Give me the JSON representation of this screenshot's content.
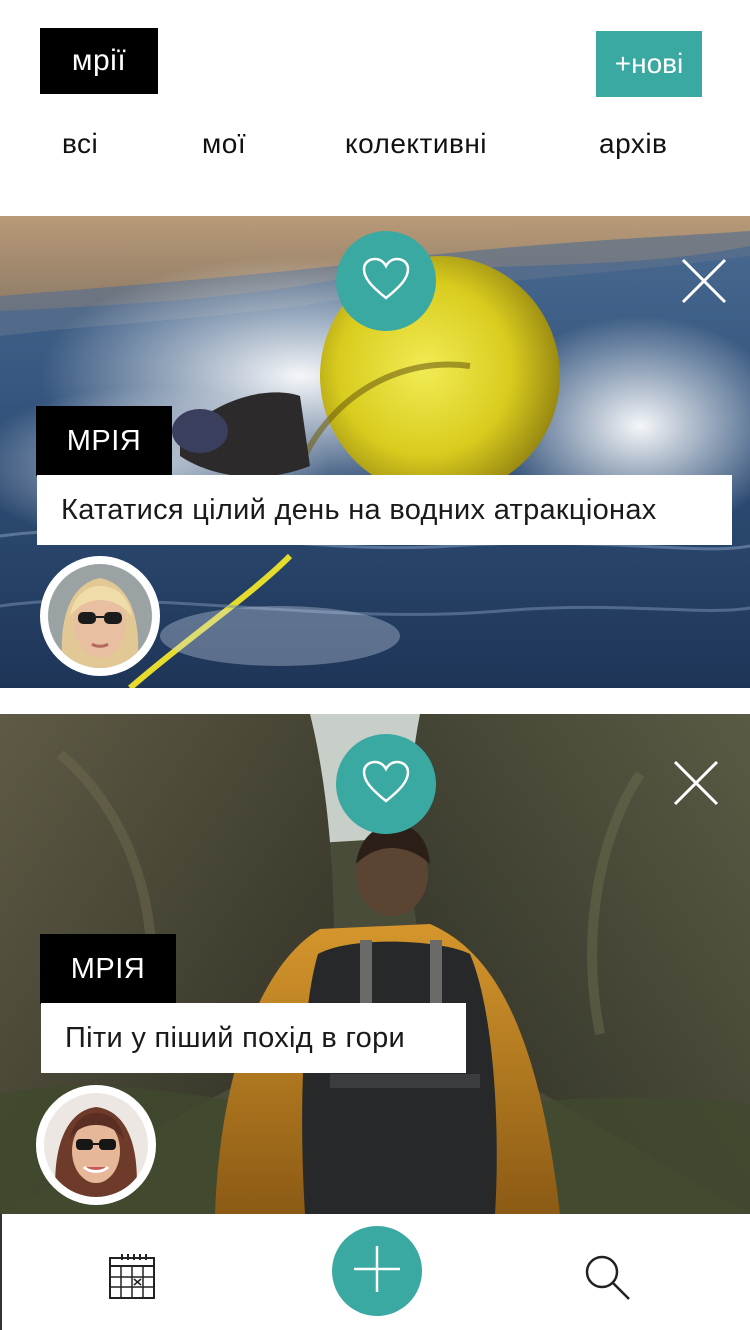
{
  "header": {
    "logo": "мрії",
    "new_button": "+нові"
  },
  "tabs": [
    {
      "label": "всі"
    },
    {
      "label": "мої"
    },
    {
      "label": "колективні"
    },
    {
      "label": "архів"
    }
  ],
  "cards": [
    {
      "tag": "МРІЯ",
      "title": "Кататися цілий день на водних атракціонах",
      "like_icon": "heart-icon",
      "close_icon": "close-icon"
    },
    {
      "tag": "МРІЯ",
      "title": "Піти у піший похід в гори",
      "like_icon": "heart-icon",
      "close_icon": "close-icon"
    }
  ],
  "bottom_nav": {
    "left_icon": "calendar-icon",
    "center_icon": "plus-icon",
    "right_icon": "search-icon"
  },
  "colors": {
    "accent": "#3aa9a1",
    "logo_bg": "#000000",
    "tag_bg": "#000000"
  }
}
